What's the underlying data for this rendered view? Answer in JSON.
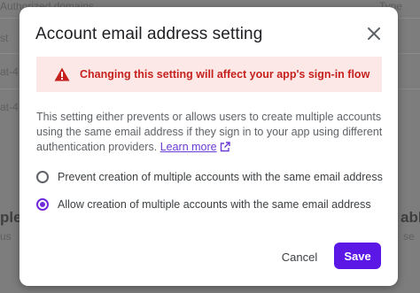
{
  "background": {
    "header_left": "Authorized domains",
    "header_right": "Type",
    "row1": "st",
    "row2": "at-4",
    "row3": "at-4",
    "section_title": "ple a",
    "section_sub": "us",
    "right_partial_1": "able",
    "right_partial_2": "se"
  },
  "dialog": {
    "title": "Account email address setting",
    "warning": {
      "text": "Changing this setting will affect your app's sign-in flow",
      "icon": "warning-icon",
      "color": "#c5221f"
    },
    "description": "This setting either prevents or allows users to create multiple accounts using the same email address if they sign in to your app using different authentication providers.",
    "learn_more": "Learn more",
    "options": [
      {
        "label": "Prevent creation of multiple accounts with the same email address",
        "checked": false
      },
      {
        "label": "Allow creation of multiple accounts with the same email address",
        "checked": true
      }
    ],
    "cancel_label": "Cancel",
    "save_label": "Save",
    "accent_color": "#5b17e6"
  }
}
